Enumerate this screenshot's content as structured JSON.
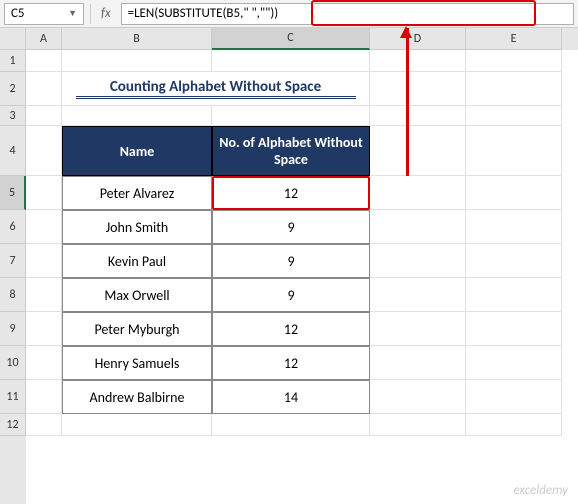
{
  "nameBox": "C5",
  "fxLabel": "fx",
  "formula": "=LEN(SUBSTITUTE(B5,\" \",\"\"))",
  "columns": [
    "A",
    "B",
    "C",
    "D",
    "E"
  ],
  "rows": [
    "1",
    "2",
    "3",
    "4",
    "5",
    "6",
    "7",
    "8",
    "9",
    "10",
    "11",
    "12"
  ],
  "title": "Counting Alphabet Without Space",
  "headers": {
    "name": "Name",
    "count": "No. of Alphabet Without Space"
  },
  "data": [
    {
      "name": "Peter Alvarez",
      "count": "12"
    },
    {
      "name": "John Smith",
      "count": "9"
    },
    {
      "name": "Kevin Paul",
      "count": "9"
    },
    {
      "name": "Max Orwell",
      "count": "9"
    },
    {
      "name": "Peter Myburgh",
      "count": "12"
    },
    {
      "name": "Henry Samuels",
      "count": "12"
    },
    {
      "name": "Andrew Balbirne",
      "count": "14"
    }
  ],
  "watermark": "exceldemy"
}
